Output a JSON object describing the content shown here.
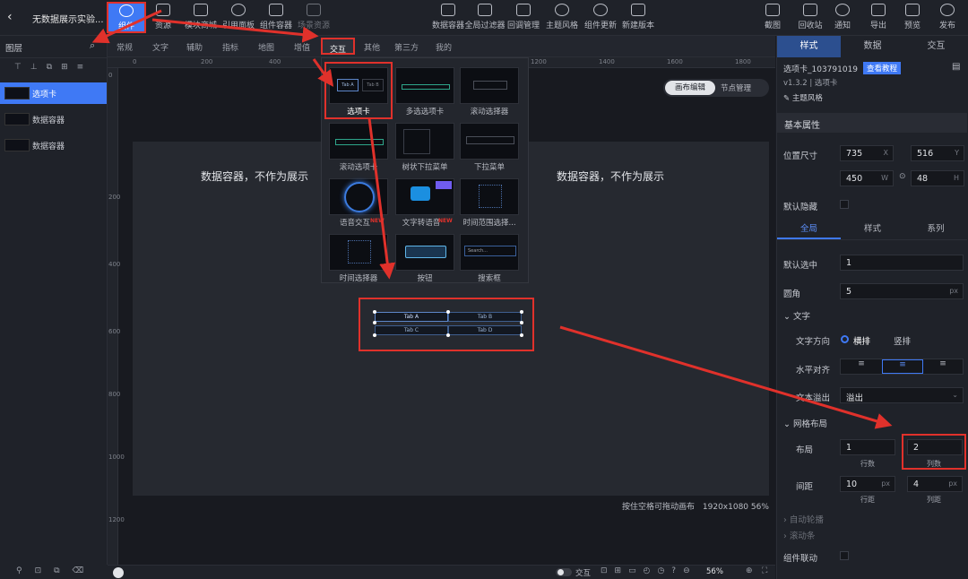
{
  "app": {
    "back_label": "‹",
    "project_title": "无数据展示实验..."
  },
  "toolbar": {
    "left": [
      {
        "name": "component",
        "label": "组件",
        "icon": "component-icon"
      },
      {
        "name": "assets",
        "label": "资源",
        "icon": "cube-icon"
      },
      {
        "name": "module-library",
        "label": "模块商城",
        "icon": "grid-icon"
      },
      {
        "name": "reference-panel",
        "label": "引用面板",
        "icon": "link-icon"
      },
      {
        "name": "component-container",
        "label": "组件容器",
        "icon": "container-icon"
      },
      {
        "name": "scene-resources",
        "label": "场景资源",
        "icon": "layers-icon"
      }
    ],
    "center": [
      {
        "name": "data-container",
        "label": "数据容器",
        "icon": "database-icon"
      },
      {
        "name": "global-filter",
        "label": "全局过滤器",
        "icon": "filter-icon"
      },
      {
        "name": "callback-manager",
        "label": "回调管理",
        "icon": "sliders-icon"
      },
      {
        "name": "theme-style",
        "label": "主题风格",
        "icon": "palette-icon"
      },
      {
        "name": "component-update",
        "label": "组件更新",
        "icon": "refresh-icon"
      },
      {
        "name": "new-version",
        "label": "新建版本",
        "icon": "new-version-icon"
      }
    ],
    "right": [
      {
        "name": "screenshot",
        "label": "截图",
        "icon": "crop-icon"
      },
      {
        "name": "recycle-bin",
        "label": "回收站",
        "icon": "trash-icon"
      },
      {
        "name": "notifications",
        "label": "通知",
        "icon": "bell-icon"
      },
      {
        "name": "export",
        "label": "导出",
        "icon": "export-icon"
      },
      {
        "name": "preview",
        "label": "预览",
        "icon": "monitor-icon"
      },
      {
        "name": "publish",
        "label": "发布",
        "icon": "send-icon"
      }
    ]
  },
  "layers": {
    "title": "图层",
    "items": [
      {
        "label": "选项卡",
        "selected": true
      },
      {
        "label": "数据容器",
        "selected": false
      },
      {
        "label": "数据容器",
        "selected": false
      }
    ]
  },
  "categories": [
    "常规",
    "文字",
    "辅助",
    "指标",
    "地图",
    "增值",
    "交互",
    "其他",
    "第三方",
    "我的"
  ],
  "active_category": "交互",
  "picker": {
    "items": [
      {
        "label": "选项卡",
        "selected": true,
        "new": false
      },
      {
        "label": "多选选项卡",
        "selected": false,
        "new": false
      },
      {
        "label": "滚动选择器",
        "selected": false,
        "new": false
      },
      {
        "label": "滚动选项卡",
        "selected": false,
        "new": false
      },
      {
        "label": "树状下拉菜单",
        "selected": false,
        "new": false
      },
      {
        "label": "下拉菜单",
        "selected": false,
        "new": false
      },
      {
        "label": "语音交互",
        "selected": false,
        "new": true
      },
      {
        "label": "文字转语音",
        "selected": false,
        "new": true
      },
      {
        "label": "时间范围选择...",
        "selected": false,
        "new": false
      },
      {
        "label": "时间选择器",
        "selected": false,
        "new": false
      },
      {
        "label": "按钮",
        "selected": false,
        "new": false
      },
      {
        "label": "搜索框",
        "selected": false,
        "new": false
      }
    ],
    "new_badge": "NEW",
    "tile_texts": {
      "tab_a": "Tab A",
      "tab_b": "Tab B",
      "search": "Search..."
    }
  },
  "canvas": {
    "modes": [
      "画布编辑",
      "节点管理"
    ],
    "active_mode": "画布编辑",
    "container_text_left": "数据容器，不作为展示",
    "container_text_right": "数据容器，不作为展示",
    "ruler_h": [
      "0",
      "200",
      "400",
      "1200",
      "1400",
      "1600",
      "1800"
    ],
    "ruler_v": [
      "0",
      "200",
      "400",
      "600",
      "800",
      "1000",
      "1200"
    ],
    "hint": "按住空格可拖动画布",
    "resolution": "1920x1080",
    "zoom_corner": "56%"
  },
  "preview_tabs": [
    "Tab A",
    "Tab B",
    "Tab C",
    "Tab D"
  ],
  "right_panel": {
    "tabs": [
      "样式",
      "数据",
      "交互"
    ],
    "active_tab": "样式",
    "component_id": "选项卡_103791019",
    "tutorial_link": "查看教程",
    "version": "v1.3.2 | 选项卡",
    "theme_style": "主题风格",
    "basic_props_title": "基本属性",
    "position_size_label": "位置尺寸",
    "x": "735",
    "y": "516",
    "w": "450",
    "h": "48",
    "x_unit": "X",
    "y_unit": "Y",
    "w_unit": "W",
    "h_unit": "H",
    "default_hidden_label": "默认隐藏",
    "subtabs": [
      "全局",
      "样式",
      "系列"
    ],
    "active_subtab": "全局",
    "default_selected_label": "默认选中",
    "default_selected": "1",
    "radius_label": "圆角",
    "radius": "5",
    "radius_unit": "px",
    "text_section": "文字",
    "text_direction_label": "文字方向",
    "dir_horizontal": "横排",
    "dir_vertical": "竖排",
    "halign_label": "水平对齐",
    "overflow_label": "文本溢出",
    "overflow_value": "溢出",
    "grid_section": "网格布局",
    "layout_label": "布局",
    "rows": "1",
    "cols": "2",
    "rows_label": "行数",
    "cols_label": "列数",
    "gap_label": "间距",
    "row_gap": "10",
    "col_gap": "4",
    "gap_unit": "px",
    "row_gap_label": "行距",
    "col_gap_label": "列距",
    "auto_wrap": "自动轮播",
    "scrollbar": "滚动条",
    "component_link": "组件联动"
  },
  "statusbar": {
    "toggle_label": "交互",
    "zoom": "56%"
  },
  "colors": {
    "accent": "#3f79f5",
    "annotation_red": "#e0312b",
    "bg_dark": "#191b22",
    "panel": "#1f2229"
  }
}
